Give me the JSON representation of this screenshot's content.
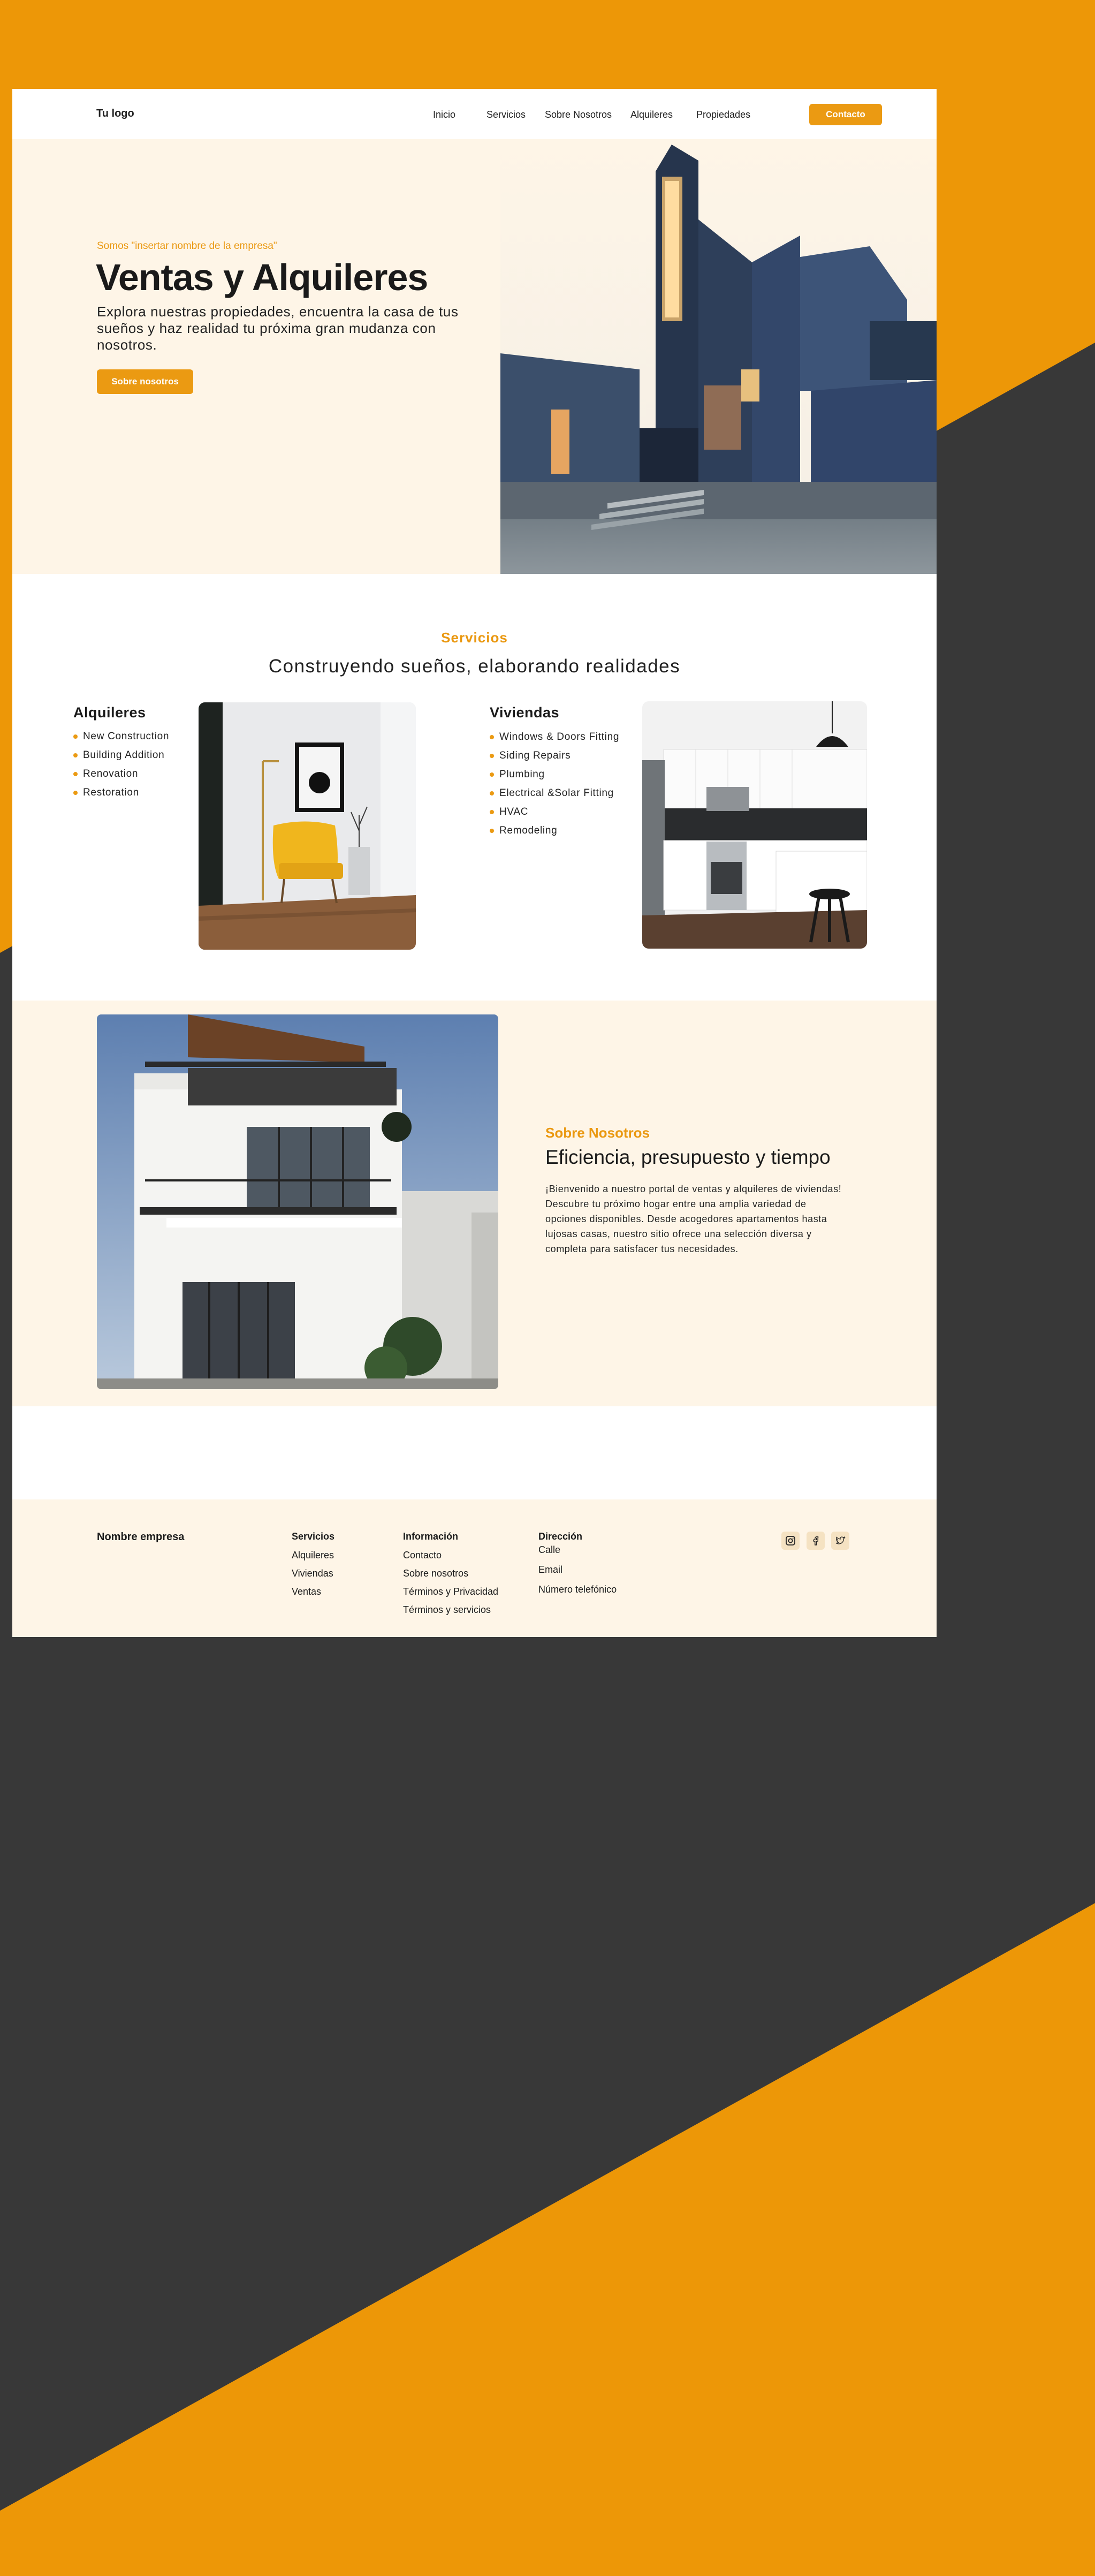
{
  "theme": {
    "accent": "#EB9A12",
    "cream": "#FEF5E7",
    "background_orange": "#ED9707",
    "background_dark": "#383838"
  },
  "nav": {
    "logo": "Tu logo",
    "items": [
      {
        "label": "Inicio"
      },
      {
        "label": "Servicios"
      },
      {
        "label": "Sobre Nosotros"
      },
      {
        "label": "Alquileres"
      },
      {
        "label": "Propiedades"
      }
    ],
    "cta_label": "Contacto"
  },
  "hero": {
    "kicker": "Somos \"insertar nombre de la empresa\"",
    "title": "Ventas y Alquileres",
    "description": "Explora nuestras propiedades, encuentra la casa de tus sueños y haz realidad tu próxima gran mudanza con nosotros.",
    "button_label": "Sobre nosotros"
  },
  "services": {
    "kicker": "Servicios",
    "title": "Construyendo sueños, elaborando realidades",
    "columns": [
      {
        "title": "Alquileres",
        "items": [
          "New Construction",
          "Building Addition",
          "Renovation",
          "Restoration"
        ]
      },
      {
        "title": "Viviendas",
        "items": [
          "Windows & Doors Fitting",
          "Siding Repairs",
          "Plumbing",
          "Electrical &Solar Fitting",
          "HVAC",
          "Remodeling"
        ]
      }
    ]
  },
  "about": {
    "kicker": "Sobre Nosotros",
    "title": "Eficiencia, presupuesto y tiempo",
    "text": "¡Bienvenido a nuestro portal de ventas y alquileres de viviendas! Descubre tu próximo hogar entre una amplia variedad de opciones disponibles. Desde acogedores apartamentos hasta lujosas casas, nuestro sitio ofrece una selección diversa y completa para satisfacer tus necesidades."
  },
  "footer": {
    "brand": "Nombre empresa",
    "columns": [
      {
        "title": "Servicios",
        "links": [
          "Alquileres",
          "Viviendas",
          "Ventas"
        ]
      },
      {
        "title": "Información",
        "links": [
          "Contacto",
          "Sobre nosotros",
          "Términos y Privacidad",
          "Términos y servicios"
        ]
      },
      {
        "title": "Dirección",
        "links": [
          "Calle",
          "Email",
          "Número telefónico"
        ]
      }
    ],
    "social_icons": [
      "instagram-icon",
      "facebook-icon",
      "twitter-icon"
    ]
  }
}
